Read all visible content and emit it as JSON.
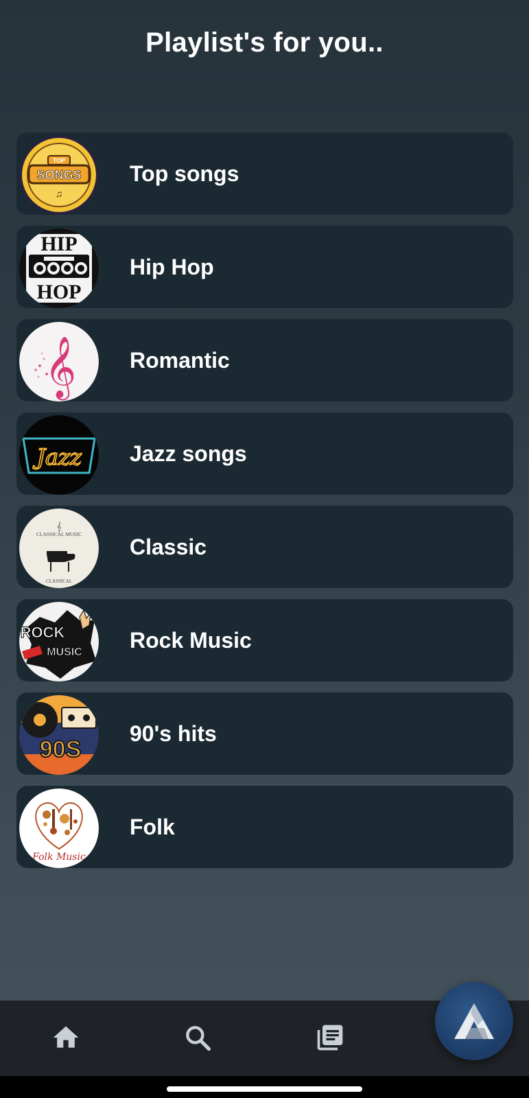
{
  "header": {
    "title": "Playlist's for you.."
  },
  "playlists": [
    {
      "label": "Top songs",
      "icon": "top-songs-badge"
    },
    {
      "label": "Hip Hop",
      "icon": "boombox"
    },
    {
      "label": "Romantic",
      "icon": "treble-clef"
    },
    {
      "label": "Jazz songs",
      "icon": "jazz-neon-sign"
    },
    {
      "label": "Classic",
      "icon": "grand-piano"
    },
    {
      "label": "Rock Music",
      "icon": "rock-hand-guitar"
    },
    {
      "label": "90's hits",
      "icon": "vinyl-cassette"
    },
    {
      "label": "Folk",
      "icon": "folk-instruments"
    }
  ],
  "art_text": {
    "top_small": "TOP",
    "top_big": "SONGS",
    "hip": "HIP",
    "hop": "HOP",
    "jazz": "Jazz",
    "classic_top": "CLASSICAL MUSIC",
    "classic_bottom": "CLASSICAL",
    "rock": "ROCK",
    "music": "MUSIC",
    "nineties": "90S",
    "folk": "Folk Music"
  },
  "nav": {
    "home": "home-icon",
    "search": "search-icon",
    "library": "library-icon",
    "fab": "assistant-logo-icon"
  },
  "colors": {
    "card": "#1b2a32",
    "nav": "#1f2226",
    "fab": "#1f3f6b",
    "icon": "#c9d1d6"
  }
}
